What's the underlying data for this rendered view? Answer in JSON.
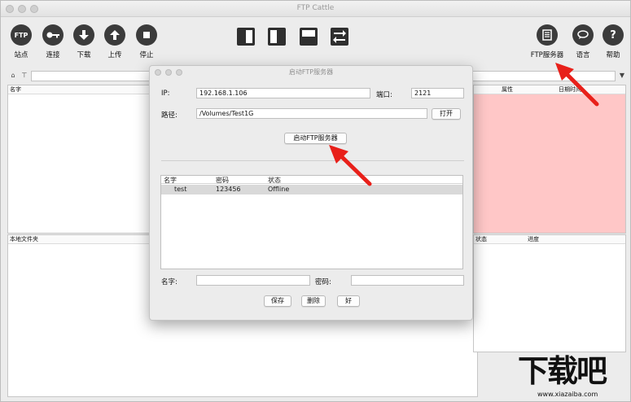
{
  "window": {
    "title": "FTP Cattle"
  },
  "toolbar": {
    "left_buttons": [
      {
        "label": "站点",
        "icon": "ftp-icon",
        "glyph": "FTP"
      },
      {
        "label": "连接",
        "icon": "key-icon",
        "glyph": "⊷"
      },
      {
        "label": "下载",
        "icon": "download-arrow-icon",
        "glyph": "⬇"
      },
      {
        "label": "上传",
        "icon": "upload-arrow-icon",
        "glyph": "⬆"
      },
      {
        "label": "停止",
        "icon": "stop-icon",
        "glyph": "■"
      }
    ],
    "right_buttons": [
      {
        "label": "FTP服务器",
        "icon": "server-icon",
        "glyph": "▤"
      },
      {
        "label": "语言",
        "icon": "speech-bubble-icon",
        "glyph": "💬"
      },
      {
        "label": "帮助",
        "icon": "question-icon",
        "glyph": "?"
      }
    ],
    "layout_icons": [
      "layout-left-pane-icon",
      "layout-right-pane-icon",
      "layout-bottom-pane-icon",
      "swap-arrows-icon"
    ]
  },
  "panes": {
    "remote_left_header": "名字",
    "remote_right_headers": [
      "属性",
      "日期时间"
    ],
    "local_header": "本地文件夹",
    "queue_headers": [
      "状态",
      "进度"
    ]
  },
  "dialog": {
    "title": "启动FTP服务器",
    "ip_label": "IP:",
    "ip_value": "192.168.1.106",
    "port_label": "端口:",
    "port_value": "2121",
    "path_label": "路径:",
    "path_value": "/Volumes/Test1G",
    "open_button": "打开",
    "start_button": "启动FTP服务器",
    "users_table": {
      "headers": [
        "名字",
        "密码",
        "状态"
      ],
      "rows": [
        {
          "name": "test",
          "password": "123456",
          "status": "Offline"
        }
      ]
    },
    "name_label": "名字:",
    "password_label": "密码:",
    "save_button": "保存",
    "delete_button": "删除",
    "ok_button": "好"
  },
  "watermark": {
    "text": "下载吧",
    "url": "www.xiazaiba.com"
  },
  "colors": {
    "arrow": "#e8201a",
    "highlight_pane": "#ffc7c7",
    "icon_dark": "#3b3b3b"
  }
}
